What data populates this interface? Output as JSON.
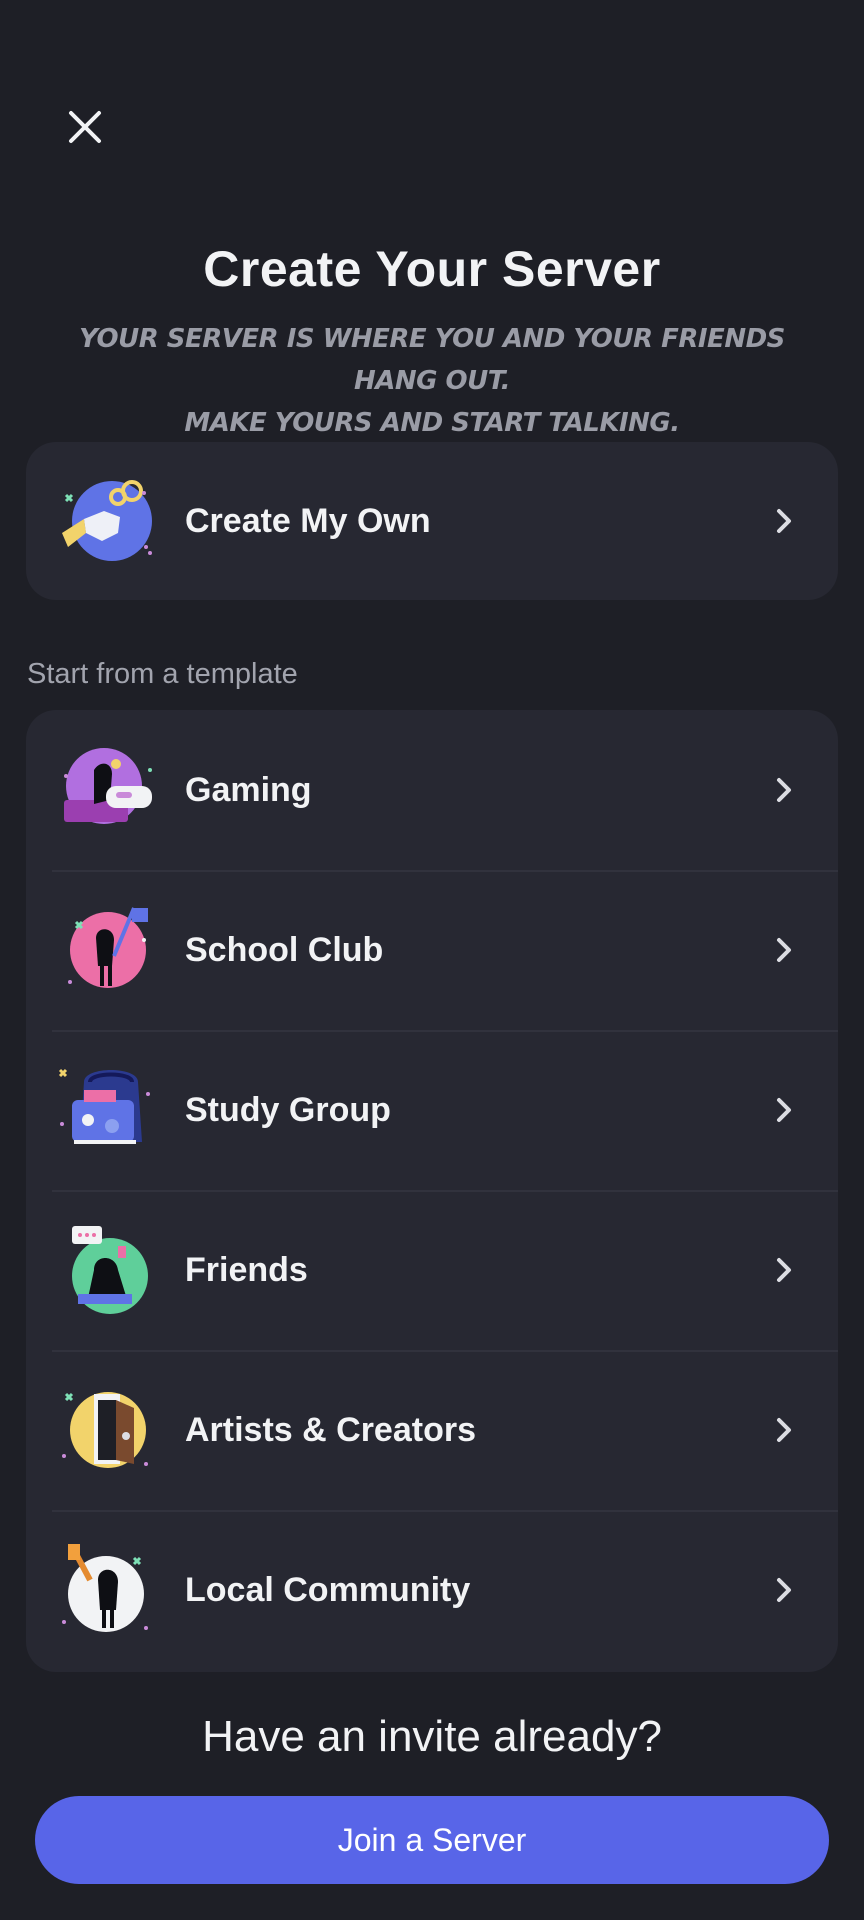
{
  "header": {
    "close_icon": "close-icon",
    "title": "Create Your Server",
    "subtitle_line1": "Your server is where you and your friends hang out.",
    "subtitle_line2": "Make yours and start talking."
  },
  "create_own": {
    "label": "Create My Own",
    "icon": "create-server-icon"
  },
  "templates": {
    "section_label": "Start from a template",
    "items": [
      {
        "label": "Gaming",
        "icon": "gaming-icon"
      },
      {
        "label": "School Club",
        "icon": "school-club-icon"
      },
      {
        "label": "Study Group",
        "icon": "study-group-icon"
      },
      {
        "label": "Friends",
        "icon": "friends-icon"
      },
      {
        "label": "Artists & Creators",
        "icon": "artists-creators-icon"
      },
      {
        "label": "Local Community",
        "icon": "local-community-icon"
      }
    ]
  },
  "footer": {
    "invite_text": "Have an invite already?",
    "join_label": "Join a Server"
  },
  "colors": {
    "background": "#1e1f26",
    "card": "#272832",
    "accent": "#5865e8",
    "text": "#f2f3f5",
    "muted": "#9a9ca6"
  }
}
